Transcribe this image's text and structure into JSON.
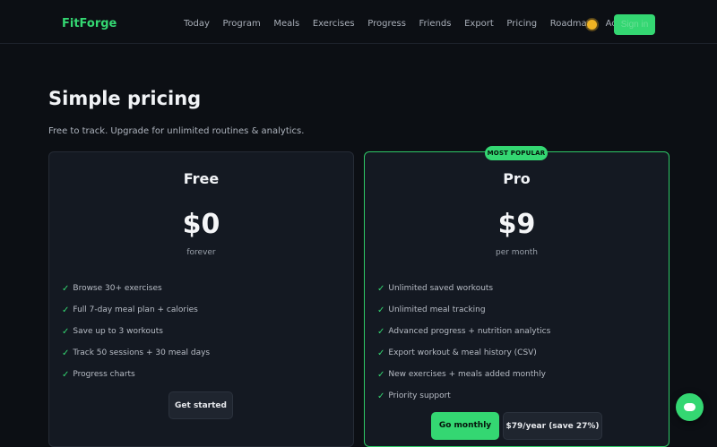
{
  "nav": {
    "brand": "FitForge",
    "links": [
      "Today",
      "Program",
      "Meals",
      "Exercises",
      "Progress",
      "Friends",
      "Export",
      "Pricing",
      "Roadmap",
      "Account"
    ],
    "signin_label": "Sign in"
  },
  "hero": {
    "title": "Simple pricing",
    "subtitle": "Free to track. Upgrade for unlimited routines & analytics."
  },
  "plans": {
    "free": {
      "name": "Free",
      "price": "$0",
      "period": "forever",
      "features": [
        "Browse 30+ exercises",
        "Full 7-day meal plan + calories",
        "Save up to 3 workouts",
        "Track 50 sessions + 30 meal days",
        "Progress charts"
      ],
      "cta": "Get started"
    },
    "pro": {
      "badge": "MOST POPULAR",
      "name": "Pro",
      "price": "$9",
      "period": "per month",
      "features": [
        "Unlimited saved workouts",
        "Unlimited meal tracking",
        "Advanced progress + nutrition analytics",
        "Export workout & meal history (CSV)",
        "New exercises + meals added monthly",
        "Priority support"
      ],
      "cta_monthly": "Go monthly",
      "cta_yearly": "$79/year (save 27%)"
    }
  },
  "icons": {
    "theme": "sun-icon",
    "check": "check-icon",
    "chat": "chat-bubble-icon"
  },
  "colors": {
    "accent": "#34d772",
    "background": "#0c0f14",
    "card": "#141922"
  }
}
